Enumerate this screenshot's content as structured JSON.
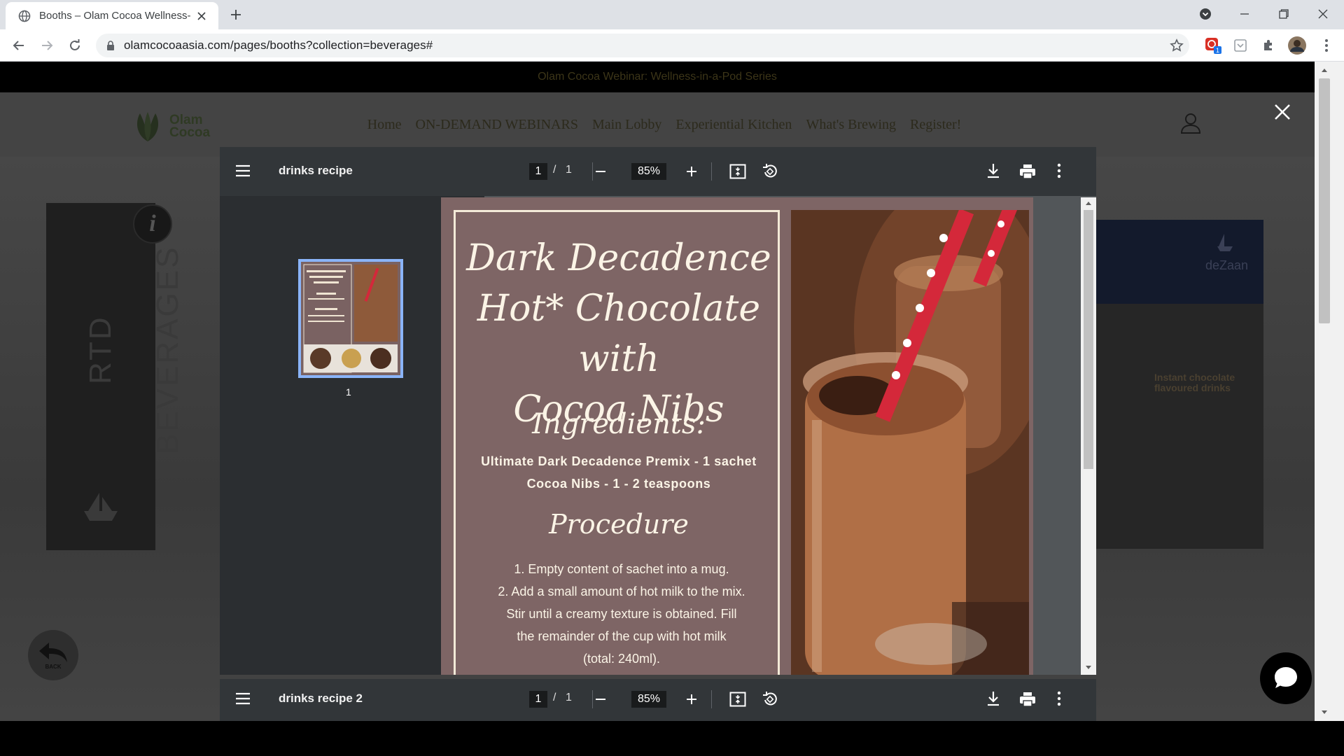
{
  "browser": {
    "tab_title": "Booths – Olam Cocoa Wellness-i",
    "url": "olamcocoaasia.com/pages/booths?collection=beverages#",
    "colors": {
      "tabstrip": "#dee1e6",
      "toolbar": "#ffffff"
    }
  },
  "site": {
    "banner": "Olam Cocoa Webinar: Wellness-in-a-Pod Series",
    "logo_line1": "Olam",
    "logo_line2": "Cocoa",
    "nav": [
      "Home",
      "ON-DEMAND WEBINARS",
      "Main Lobby",
      "Experiential Kitchen",
      "What's Brewing",
      "Register!"
    ],
    "booth_label": "RTD BEVERAGES",
    "info_icon_label": "i",
    "back_label": "BACK",
    "right_brand": "deZaan",
    "right_poster_title": "Instant chocolate flavoured drinks"
  },
  "pdf1": {
    "title": "drinks recipe",
    "page_current": "1",
    "page_sep": "/",
    "page_total": "1",
    "zoom": "85%",
    "thumb_number": "1",
    "recipe": {
      "title_lines": [
        "Dark Decadence",
        "Hot* Chocolate with",
        "Cocoa Nibs"
      ],
      "ingredients_heading": "Ingredients:",
      "ingredients": [
        "Ultimate Dark Decadence Premix - 1 sachet",
        "Cocoa Nibs - 1 - 2 teaspoons"
      ],
      "procedure_heading": "Procedure",
      "steps": [
        "1.      Empty content of sachet into a mug.",
        "2. Add a small amount of hot milk to the  mix.",
        "Stir until a creamy texture is obtained. Fill",
        "the remainder of the cup with hot milk",
        "(total: 240ml)."
      ]
    }
  },
  "pdf2": {
    "title": "drinks recipe 2",
    "page_current": "1",
    "page_sep": "/",
    "page_total": "1",
    "zoom": "85%"
  },
  "colors": {
    "pdf_toolbar": "#323639",
    "recipe_bg": "#7e6565",
    "accent": "#8ab4f8",
    "straw": "#d4283a"
  }
}
